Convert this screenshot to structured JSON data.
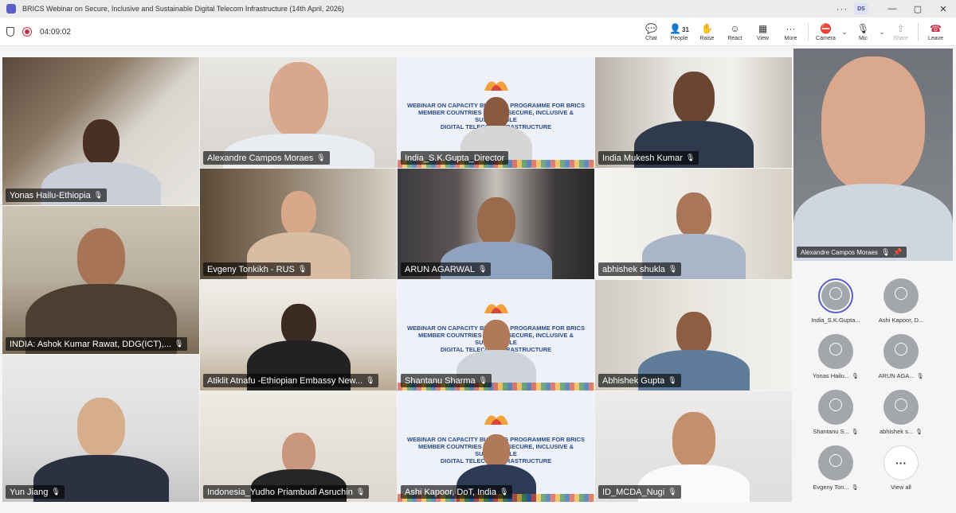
{
  "window": {
    "title": "BRICS Webinar on Secure, Inclusive and Sustainable Digital Telecom Infrastructure (14th April, 2026)",
    "user_initials": "DS",
    "more_icon": "ellipsis-icon"
  },
  "meeting": {
    "timer": "04:09:02",
    "participant_count": "31"
  },
  "toolbar": {
    "chat": "Chat",
    "people": "People",
    "raise": "Raise",
    "react": "React",
    "view": "View",
    "more": "More",
    "camera": "Camera",
    "mic": "Mic",
    "share": "Share",
    "leave": "Leave"
  },
  "slide": {
    "line1": "WEBINAR ON CAPACITY BUILDING PROGRAMME FOR BRICS",
    "line2": "MEMBER COUNTRIES ON THE SECURE, INCLUSIVE & SUSTAINABLE",
    "line3": "DIGITAL TELECOM INFRASTRUCTURE",
    "logo": "BRICS"
  },
  "tiles": [
    {
      "name": "Yonas Hailu-Ethiopia"
    },
    {
      "name": "Alexandre Campos Moraes"
    },
    {
      "name": "India_S.K.Gupta_Director"
    },
    {
      "name": "India Mukesh Kumar"
    },
    {
      "name": "INDIA: Ashok Kumar Rawat, DDG(ICT),..."
    },
    {
      "name": "Evgeny Tonkikh - RUS"
    },
    {
      "name": "ARUN AGARWAL"
    },
    {
      "name": "abhishek shukla"
    },
    {
      "name": "Atiklit Atnafu -Ethiopian Embassy New..."
    },
    {
      "name": "Shantanu Sharma"
    },
    {
      "name": "Abhishek Gupta"
    },
    {
      "name": "Yun Jiang"
    },
    {
      "name": "Indonesia_Yudho Priambudi Asruchin"
    },
    {
      "name": "Ashi Kapoor, DoT, India"
    },
    {
      "name": "ID_MCDA_Nugi"
    }
  ],
  "pinned": {
    "name": "Alexandre Campos Moraes"
  },
  "roster": [
    {
      "name": "India_S.K.Gupta..."
    },
    {
      "name": "Ashi Kapoor, D..."
    },
    {
      "name": "Yonas Hailu..."
    },
    {
      "name": "ARUN AGA..."
    },
    {
      "name": "Shantanu S..."
    },
    {
      "name": "abhishek s..."
    },
    {
      "name": "Evgeny Ton..."
    },
    {
      "name": "View all"
    }
  ]
}
